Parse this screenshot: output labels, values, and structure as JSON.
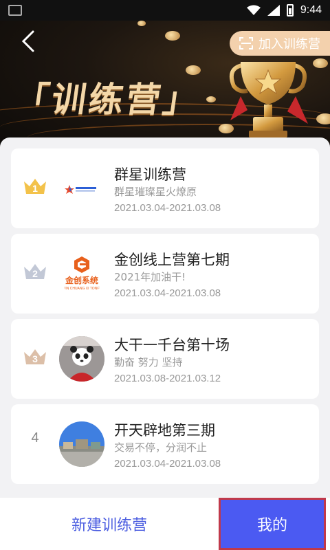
{
  "status_bar": {
    "time": "9:44"
  },
  "header": {
    "join_label": "加入训练营",
    "banner_title": "「训练营」"
  },
  "camps": [
    {
      "rank": "1",
      "title": "群星训练营",
      "subtitle": "群星璀璨星火燎原",
      "dates": "2021.03.04-2021.03.08",
      "logo": "star-logo"
    },
    {
      "rank": "2",
      "title": "金创线上营第七期",
      "subtitle": "2021年加油干!",
      "dates": "2021.03.04-2021.03.08",
      "logo": "jinchuang-logo",
      "logo_text": "金创系统",
      "logo_subtext": "JIN CHUANG XI TONG"
    },
    {
      "rank": "3",
      "title": "大干一千台第十场",
      "subtitle": "勤奋 努力 坚持",
      "dates": "2021.03.08-2021.03.12",
      "logo": "panda-avatar"
    },
    {
      "rank": "4",
      "title": "开天辟地第三期",
      "subtitle": "交易不停，分润不止",
      "dates": "2021.03.04-2021.03.08",
      "logo": "landscape-avatar"
    }
  ],
  "bottom": {
    "new_label": "新建训练营",
    "mine_label": "我的"
  },
  "colors": {
    "accent": "#4b5af2",
    "gold": "#e8b44a",
    "silver": "#c2c8d6",
    "bronze": "#d8b89e"
  }
}
